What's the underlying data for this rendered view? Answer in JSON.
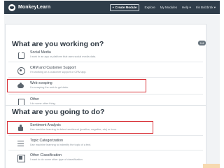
{
  "app": {
    "brand": "MonkeyLearn",
    "nav": {
      "create_module": "+ Create Module",
      "explore": "Explore",
      "my_modules": "My Modules",
      "help": "Help ▾",
      "user": "Iris Bolzbrük ▾"
    }
  },
  "section1": {
    "heading": "What are you working on?",
    "badge": "1/4",
    "options": [
      {
        "icon": "social-media-icon",
        "title": "Social Media",
        "desc": "I work in an app or platform that uses social media data."
      },
      {
        "icon": "crm-icon",
        "title": "CRM and Customer Support",
        "desc": "I'm working on a customer support or CRM app."
      },
      {
        "icon": "web-scraping-icon",
        "title": "Web scraping",
        "desc": "I'm scraping the web to get data.",
        "highlighted": true
      },
      {
        "icon": "other-icon",
        "title": "Other",
        "desc": "I do some other thing."
      }
    ]
  },
  "section2": {
    "heading": "What are you going to do?",
    "options": [
      {
        "icon": "thumbs-up-icon",
        "title": "Sentiment Analysis",
        "desc": "Use machine learning to detect sentiment (positive, negative, etc) or tone.",
        "highlighted": true
      },
      {
        "icon": "topic-icon",
        "title": "Topic Categorization",
        "desc": "Use machine learning to indentify the topic of a text."
      },
      {
        "icon": "other-classification-icon",
        "title": "Other Classification",
        "desc": "I want to do some other type of classification."
      }
    ]
  },
  "colors": {
    "nav_bg": "#2f3d4a",
    "highlight": "#d9343a",
    "page_bg": "#f1f3f5"
  }
}
